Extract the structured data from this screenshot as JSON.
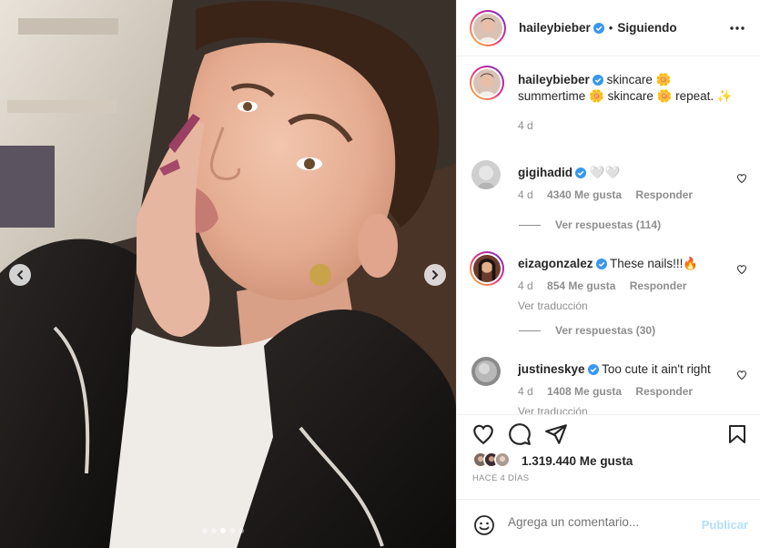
{
  "photo": {
    "total_slides": 5,
    "active_slide": 2
  },
  "post": {
    "author": "haileybieber",
    "follow_status": "Siguiendo",
    "caption": "skincare 🌼 summertime 🌼 skincare 🌼 repeat. ✨",
    "caption_age": "4 d"
  },
  "comments": [
    {
      "user": "gigihadid",
      "text": "🤍🤍",
      "age": "4 d",
      "likes": "4340 Me gusta",
      "reply": "Responder",
      "view_replies": "Ver respuestas (114)",
      "translate": ""
    },
    {
      "user": "eizagonzalez",
      "text": "These nails!!!🔥",
      "age": "4 d",
      "likes": "854 Me gusta",
      "reply": "Responder",
      "translate": "Ver traducción",
      "view_replies": "Ver respuestas (30)"
    },
    {
      "user": "justineskye",
      "text": "Too cute it ain't right",
      "age": "4 d",
      "likes": "1408 Me gusta",
      "reply": "Responder",
      "translate": "Ver traducción",
      "view_replies": ""
    }
  ],
  "footer": {
    "likes_count": "1.319.440 Me gusta",
    "time_ago": "HACE 4 DÍAS",
    "comment_placeholder": "Agrega un comentario...",
    "publish_label": "Publicar"
  },
  "icons": {
    "like": "heart-icon",
    "comment": "comment-icon",
    "share": "share-icon",
    "save": "bookmark-icon",
    "emoji": "emoji-icon",
    "more": "more-options-icon",
    "verified": "verified-badge-icon"
  },
  "colors": {
    "verified": "#3897f0",
    "publish_disabled": "#b2dffc",
    "muted_text": "#8e8e8e"
  }
}
